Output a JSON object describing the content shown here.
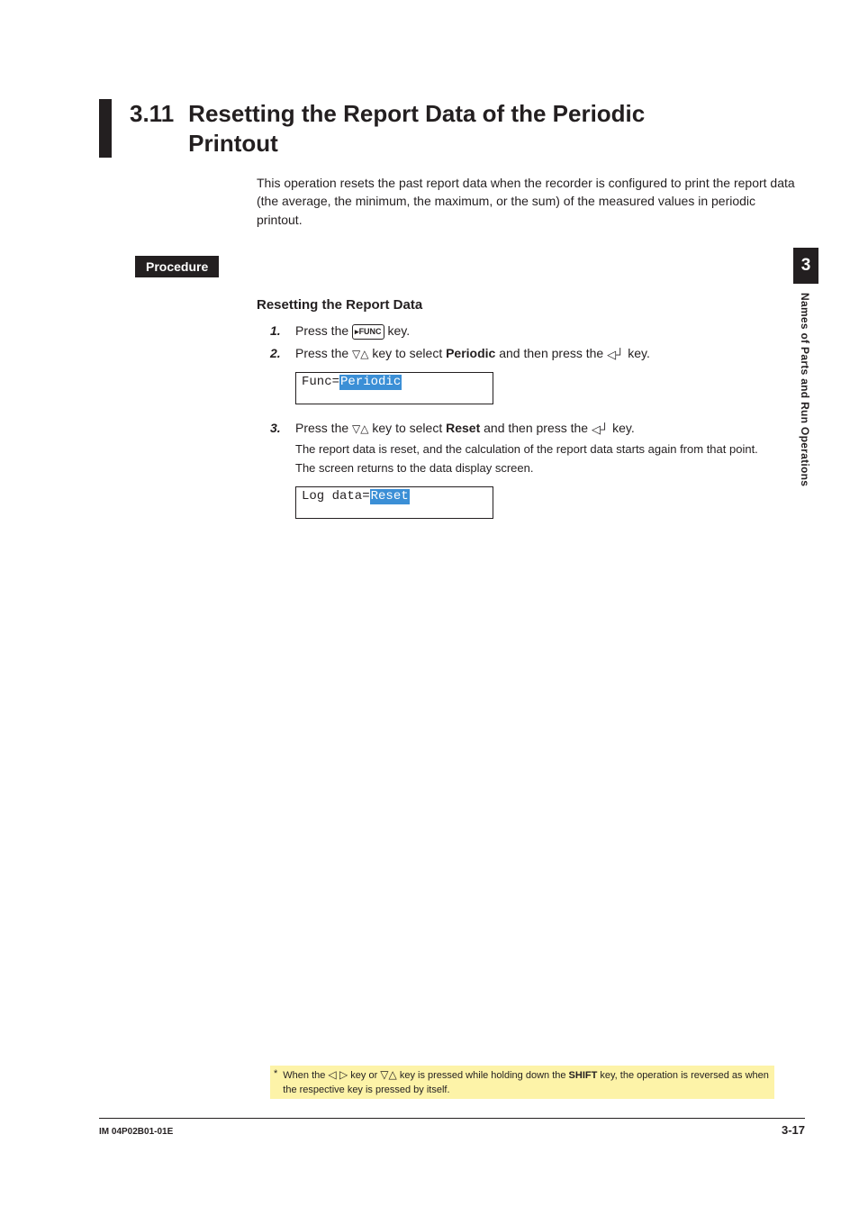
{
  "side": {
    "chapter": "3",
    "label": "Names of Parts and Run Operations"
  },
  "heading": {
    "num": "3.11",
    "title": "Resetting the Report Data of the Periodic Printout"
  },
  "intro": "This operation resets the past report data when the recorder is configured to print the report data (the average, the minimum, the maximum, or the sum) of the measured values in periodic printout.",
  "procedure": {
    "label": "Procedure",
    "subheading": "Resetting the Report Data"
  },
  "keys": {
    "func_prefix": "▸",
    "func_text": "FUNC"
  },
  "steps": {
    "s1": {
      "num": "1.",
      "a": "Press the ",
      "b": " key."
    },
    "s2": {
      "num": "2.",
      "a": "Press the ",
      "b": " key to select ",
      "bold": "Periodic",
      "c": " and then press the ",
      "d": " key."
    },
    "s3": {
      "num": "3.",
      "a": "Press the ",
      "b": " key to select ",
      "bold": "Reset",
      "c": " and then press the ",
      "d": " key.",
      "sub1": "The report data is reset, and the calculation of the report data starts again from that point.",
      "sub2": "The screen returns to the data display screen."
    }
  },
  "lcd1": {
    "pre": "Func=",
    "sel": "Periodic"
  },
  "lcd2": {
    "pre": "Log data=",
    "sel": "Reset"
  },
  "footnote": {
    "star": "*",
    "a": "When the ",
    "b": " key or ",
    "c": " key is pressed while holding down the ",
    "shift": "SHIFT",
    "d": " key, the operation is reversed as when the respective key is pressed by itself."
  },
  "footer": {
    "left": "IM 04P02B01-01E",
    "right": "3-17"
  }
}
